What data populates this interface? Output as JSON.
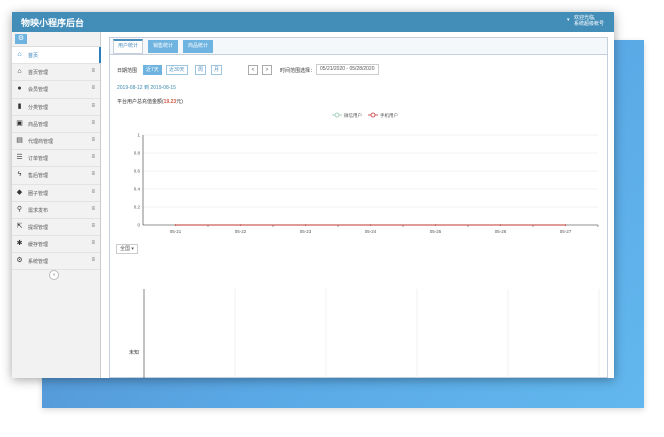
{
  "app": {
    "title": "物映小程序后台",
    "user_line1": "欢迎光临,",
    "user_line2": "系统超级帐号"
  },
  "sidebar": {
    "items": [
      {
        "label": "首页",
        "icon": "home-icon",
        "active": true
      },
      {
        "label": "首页管理",
        "icon": "home-icon"
      },
      {
        "label": "会员管理",
        "icon": "user-icon"
      },
      {
        "label": "分类管理",
        "icon": "bookmark-icon"
      },
      {
        "label": "商品管理",
        "icon": "gift-icon"
      },
      {
        "label": "代理商管理",
        "icon": "briefcase-icon"
      },
      {
        "label": "订单管理",
        "icon": "list-icon"
      },
      {
        "label": "售后管理",
        "icon": "bolt-icon"
      },
      {
        "label": "圈子管理",
        "icon": "comments-icon"
      },
      {
        "label": "需求发布",
        "icon": "search-icon"
      },
      {
        "label": "提现管理",
        "icon": "share-icon"
      },
      {
        "label": "缓存管理",
        "icon": "asterisk-icon"
      },
      {
        "label": "系统管理",
        "icon": "cogs-icon"
      }
    ]
  },
  "tabs": [
    {
      "label": "用户统计",
      "active": true
    },
    {
      "label": "销售统计",
      "active": false
    },
    {
      "label": "商品统计",
      "active": false
    }
  ],
  "filters": {
    "date_range_label": "日期范围",
    "btn_7days": "近7天",
    "btn_30days": "近30天",
    "btn_week": "周",
    "btn_month": "月",
    "prev": "<",
    "next": ">",
    "time_range_label": "时间范围选择：",
    "time_range_value": "05/21/2020 - 05/28/2020"
  },
  "date_from": "2019-08-12",
  "date_to_word": "到",
  "date_to": "2019-08-15",
  "total_prefix": "平台用户总充值金额(",
  "total_value": "19.23",
  "total_suffix": "元)",
  "region_select": "全国",
  "map_label": "未知",
  "chart_data": {
    "type": "line",
    "x": [
      "05-21",
      "05-22",
      "05-23",
      "05-24",
      "05-25",
      "05-26",
      "05-27"
    ],
    "series": [
      {
        "name": "微信用户",
        "values": [
          0,
          0,
          0,
          0,
          0,
          0,
          0
        ],
        "color": "#91c7ae"
      },
      {
        "name": "手机用户",
        "values": [
          0,
          0,
          0,
          0,
          0,
          0,
          0
        ],
        "color": "#c23531"
      }
    ],
    "ylim": [
      0,
      1
    ],
    "yticks": [
      0,
      0.2,
      0.4,
      0.6,
      0.8,
      1
    ],
    "ytick_labels": [
      "0",
      "0.2",
      "0.4",
      "0.6",
      "0.8",
      "1"
    ],
    "grid": true,
    "legend": "top-center"
  },
  "colors": {
    "accent": "#438eb9",
    "tab": "#6fb3e0",
    "highlight": "#d15b47"
  }
}
